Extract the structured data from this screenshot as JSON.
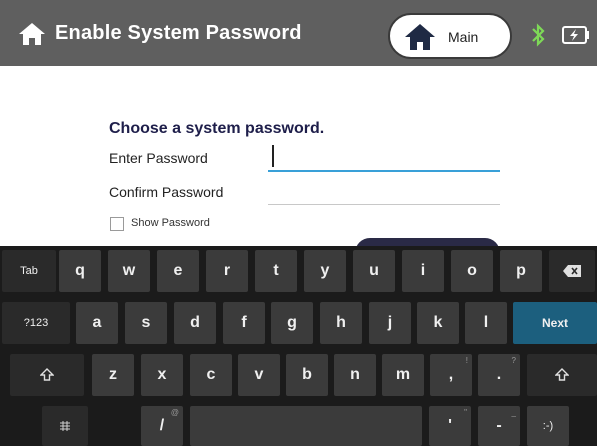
{
  "header": {
    "title": "Enable System Password",
    "main_label": "Main",
    "icons": [
      "home-icon",
      "bluetooth-icon",
      "battery-icon"
    ],
    "background_color": "#5f5f5f"
  },
  "form": {
    "title": "Choose a system password.",
    "enter_label": "Enter Password",
    "confirm_label": "Confirm Password",
    "enter_value": "",
    "confirm_value": "",
    "show_password_label": "Show Password",
    "show_password_checked": false,
    "focus_color": "#39a0d8"
  },
  "keyboard": {
    "row1": [
      "Tab",
      "q",
      "w",
      "e",
      "r",
      "t",
      "y",
      "u",
      "i",
      "o",
      "p"
    ],
    "row2": [
      "?123",
      "a",
      "s",
      "d",
      "f",
      "g",
      "h",
      "j",
      "k",
      "l",
      "Next"
    ],
    "row3": [
      "z",
      "x",
      "c",
      "v",
      "b",
      "n",
      "m",
      ",",
      "."
    ],
    "row3_sup": [
      "!",
      "?"
    ],
    "row4": [
      "/",
      "'",
      "-",
      ":-)"
    ],
    "row4_sup": [
      "@",
      "\"",
      "_"
    ],
    "next_color": "#1c5f7e"
  }
}
